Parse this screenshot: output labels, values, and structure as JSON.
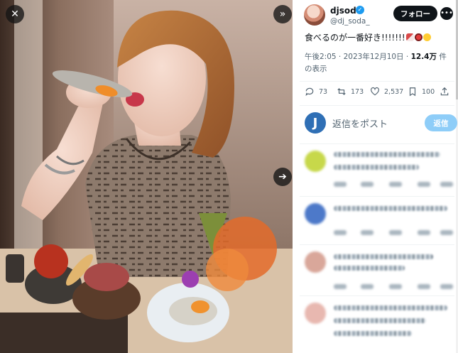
{
  "media": {
    "close_icon": "close-icon",
    "expand_icon": "expand-icon",
    "next_icon": "chevron-right-icon"
  },
  "author": {
    "display_name": "djsoda",
    "handle": "@dj_soda_",
    "verified": true
  },
  "header": {
    "follow_label": "フォロー",
    "more_icon": "more-icon"
  },
  "tweet": {
    "text": "食べるのが一番好き!!!!!!!",
    "emojis": [
      "bacon",
      "sushi",
      "yum-face"
    ],
    "time": "午後2:05",
    "date": "2023年12月10日",
    "views": "12.4万",
    "views_suffix": "件の表示"
  },
  "stats": {
    "replies": "73",
    "reposts": "173",
    "likes": "2,537",
    "bookmarks": "100"
  },
  "reply_box": {
    "placeholder": "返信をポスト",
    "button_label": "返信",
    "avatar_letter": "J"
  },
  "colors": {
    "accent": "#1d9bf0",
    "reply_button": "#8ecdf8",
    "follow_button": "#0f1419",
    "muted_text": "#536471"
  }
}
